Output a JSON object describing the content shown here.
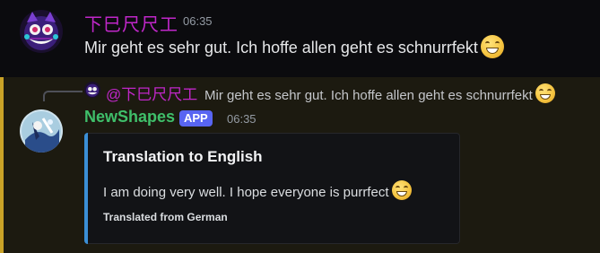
{
  "message1": {
    "author": "下巳尺尺工",
    "timestamp": "06:35",
    "text": "Mir geht es sehr gut. Ich hoffe allen geht es schnurrfekt",
    "emoji": "grinning-face-with-smiling-eyes"
  },
  "message2": {
    "reply": {
      "author": "@下巳尺尺工",
      "text": "Mir geht es sehr gut. Ich hoffe allen geht es schnurrfekt"
    },
    "author": "NewShapes",
    "badge": "APP",
    "timestamp": "06:35",
    "embed": {
      "title": "Translation to English",
      "description": "I am doing very well. I hope everyone is purrfect",
      "footer": "Translated from German"
    }
  },
  "colors": {
    "author1": "#c027c9",
    "author2": "#3fbf6a",
    "app_badge": "#5865f2",
    "embed_accent": "#3b8fd6",
    "mention_highlight_bar": "#c9a227"
  }
}
